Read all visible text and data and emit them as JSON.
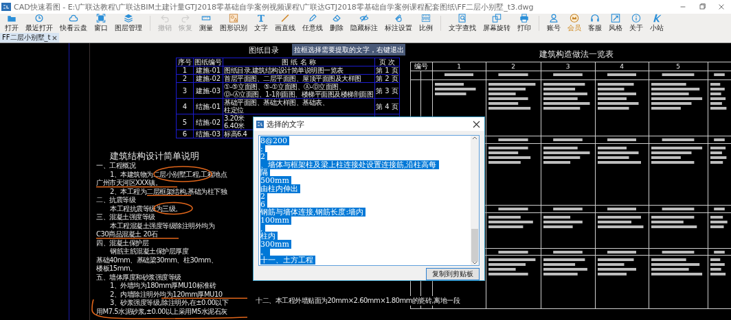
{
  "window": {
    "title": "CAD快速看图 - E:\\广联达教程\\广联达BIM土建计量GTJ2018零基础自学案例视频课程\\广联达GTJ2018零基础自学案例课程配套图纸\\FF二层小别墅_t3.dwg"
  },
  "toolbar": [
    {
      "items": [
        {
          "label": "打开",
          "kind": "tool",
          "disabled": false
        },
        {
          "label": "最近打开",
          "kind": "tool",
          "disabled": false
        },
        {
          "label": "快看云盘",
          "kind": "tool",
          "disabled": false
        },
        {
          "label": "窗口",
          "kind": "tool",
          "disabled": false
        },
        {
          "label": "图层管理",
          "kind": "tool",
          "disabled": false
        }
      ]
    },
    {
      "items": [
        {
          "label": "撤销",
          "kind": "tool",
          "disabled": true
        },
        {
          "label": "恢复",
          "kind": "tool",
          "disabled": true
        },
        {
          "label": "测量",
          "kind": "tool",
          "disabled": false
        },
        {
          "label": "图形识别",
          "kind": "tool",
          "disabled": false
        },
        {
          "label": "文字",
          "kind": "tool",
          "disabled": false
        },
        {
          "label": "画直线",
          "kind": "tool",
          "disabled": false
        },
        {
          "label": "任意线",
          "kind": "tool",
          "disabled": false
        },
        {
          "label": "删除",
          "kind": "tool",
          "disabled": false
        },
        {
          "label": "隐藏标注",
          "kind": "tool",
          "disabled": false
        },
        {
          "label": "标注设置",
          "kind": "tool",
          "disabled": false
        },
        {
          "label": "比例",
          "kind": "tool",
          "disabled": false
        }
      ]
    },
    {
      "items": [
        {
          "label": "文字查找",
          "kind": "tool",
          "disabled": false
        },
        {
          "label": "屏幕旋转",
          "kind": "tool",
          "disabled": false
        },
        {
          "label": "打印",
          "kind": "tool",
          "disabled": false
        }
      ]
    },
    {
      "items": [
        {
          "label": "账号",
          "kind": "tool",
          "disabled": false
        },
        {
          "label": "会员",
          "kind": "premium",
          "disabled": false
        },
        {
          "label": "客服",
          "kind": "tool",
          "disabled": false
        },
        {
          "label": "风格",
          "kind": "tool",
          "disabled": false
        },
        {
          "label": "关于",
          "kind": "tool",
          "disabled": false
        },
        {
          "label": "小站",
          "kind": "tool",
          "disabled": false
        }
      ]
    }
  ],
  "tabs": [
    {
      "label": "FF二层小别墅_t",
      "selected": true
    }
  ],
  "drawing": {
    "index_title": "图纸目录",
    "hint": "拉框选择需要提取的文字，右键退出",
    "index_table": {
      "columns": [
        "序号",
        "图纸编号",
        "图 纸 名 称",
        "页 次"
      ],
      "rows": [
        {
          "number": "1",
          "code": "建施-01",
          "names": [
            "图纸目录,建筑结构设计简单说明图一览表"
          ],
          "page": "第 1 页"
        },
        {
          "number": "2",
          "code": "建施-02",
          "names": [
            "首层平面图、二层平面图、屋顶平面图及大样图"
          ],
          "page": "第 2 页"
        },
        {
          "number": "3",
          "code": "建施-03",
          "names": [
            "①-⑤立面图、⑤-①立面图、Ⓐ-Ⓓ立面图、",
            "Ⓓ-Ⓐ立面图、1-1剖面图、楼梯平面图及楼梯剖面图"
          ],
          "page": "第 3 页"
        },
        {
          "number": "4",
          "code": "结施-01",
          "names": [
            "基础平面图、基础大样图、基础表、",
            "柱定位"
          ],
          "page": "第 4 页"
        },
        {
          "number": "5",
          "code": "结施-02",
          "names": [
            "3.20米",
            "6.40米"
          ]
        },
        {
          "number": "6",
          "code": "结施-03",
          "names": [
            "标高6.4"
          ]
        }
      ]
    },
    "notes": {
      "title": "建筑结构设计简单说明",
      "lines": [
        {
          "text": "一、工程概况",
          "kind": "heading"
        },
        {
          "text": "1、本建筑物为二层小别墅工程,工程地点",
          "kind": "indented"
        },
        {
          "text": "广州市天河区XXX镇。",
          "kind": "plain"
        },
        {
          "text": "2、本工程为二层框架结构,基础为柱下独",
          "kind": "indented"
        },
        {
          "text": "二、抗震等级",
          "kind": "heading"
        },
        {
          "text": "本工程抗震等级为三级。",
          "kind": "indented"
        },
        {
          "text": "三、混凝土强度等级",
          "kind": "heading"
        },
        {
          "text": "本工程混凝土强度等级除注明外均为",
          "kind": "indented"
        },
        {
          "text": "C30商品混凝土 20石",
          "kind": "plain"
        },
        {
          "text": "四、混凝土保护层",
          "kind": "heading"
        },
        {
          "text": "钢筋主筋混凝土保护层厚度",
          "kind": "indented"
        },
        {
          "text": "基础40mm、基础梁30mm、柱30mm、",
          "kind": "plain"
        },
        {
          "text": "楼板15mm。",
          "kind": "plain"
        },
        {
          "text": "五、墙体厚度和砂浆强度等级",
          "kind": "heading"
        },
        {
          "text": "1、外墙均为180mm厚MU10标准砖",
          "kind": "indented"
        },
        {
          "text": "2、内墙除注明外均为120mm厚MU10",
          "kind": "indented"
        },
        {
          "text": "3、砂浆强度等级,除注明外,在±0.00以下",
          "kind": "indented"
        },
        {
          "text": "用M7.5水泥砂浆,±0.00以上采用M5水泥石灰",
          "kind": "plain"
        }
      ]
    },
    "bottom_note": "十二、本工程外墙贴面为20mm×2.60mm×1.80mm的瓷砖,离地一段",
    "spec_table": {
      "title": "建筑构造做法一览表",
      "header": "编号",
      "columns": [
        "1",
        "2",
        "3",
        "4",
        "5"
      ]
    }
  },
  "dialog": {
    "title": "选择的文字",
    "lines": [
      "8@200",
      ":",
      "2",
      "、墙体与框架柱及梁上柱连接处设置连接筋,沿柱高每",
      "隔",
      "500mm",
      "由柱内伸出",
      "2",
      "6",
      "钢筋与墙体连接,钢筋长度:墙内",
      "100mm",
      ",",
      "柱内",
      "300mm",
      "。",
      "十一、土方工程"
    ],
    "button": "复制到剪贴板"
  }
}
